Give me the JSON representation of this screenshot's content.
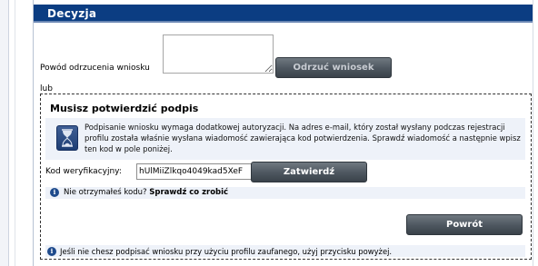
{
  "panel": {
    "title": "Decyzja"
  },
  "reject": {
    "reason_label": "Powód odrzucenia wniosku",
    "reason_value": "",
    "button_label": "Odrzuć wniosek"
  },
  "or_label": "lub",
  "signature": {
    "title": "Musisz potwierdzić podpis",
    "info_text": "Podpisanie wniosku wymaga dodatkowej autoryzacji. Na adres e-mail, który został wysłany podczas rejestracji profilu została właśnie wysłana wiadomość zawierająca kod potwierdzenia. Sprawdź wiadomość a następnie wpisz ten kod w pole poniżej.",
    "code_label": "Kod weryfikacyjny:",
    "code_value": "hUlMiiZlkqo4049kad5XeF",
    "confirm_label": "Zatwierdź",
    "hint_question": "Nie otrzymałeś kodu?",
    "hint_link": "Sprawdź co zrobić",
    "back_label": "Powrót",
    "footer_text": "Jeśli nie chesz podpisać wniosku przy użyciu profilu zaufanego, użyj przycisku powyżej."
  },
  "icons": {
    "hourglass": "hourglass-icon",
    "info": "info-icon"
  },
  "colors": {
    "header_bg": "#0b3d82",
    "button_bg": "#4d565f",
    "info_bg": "#eef2f9"
  }
}
